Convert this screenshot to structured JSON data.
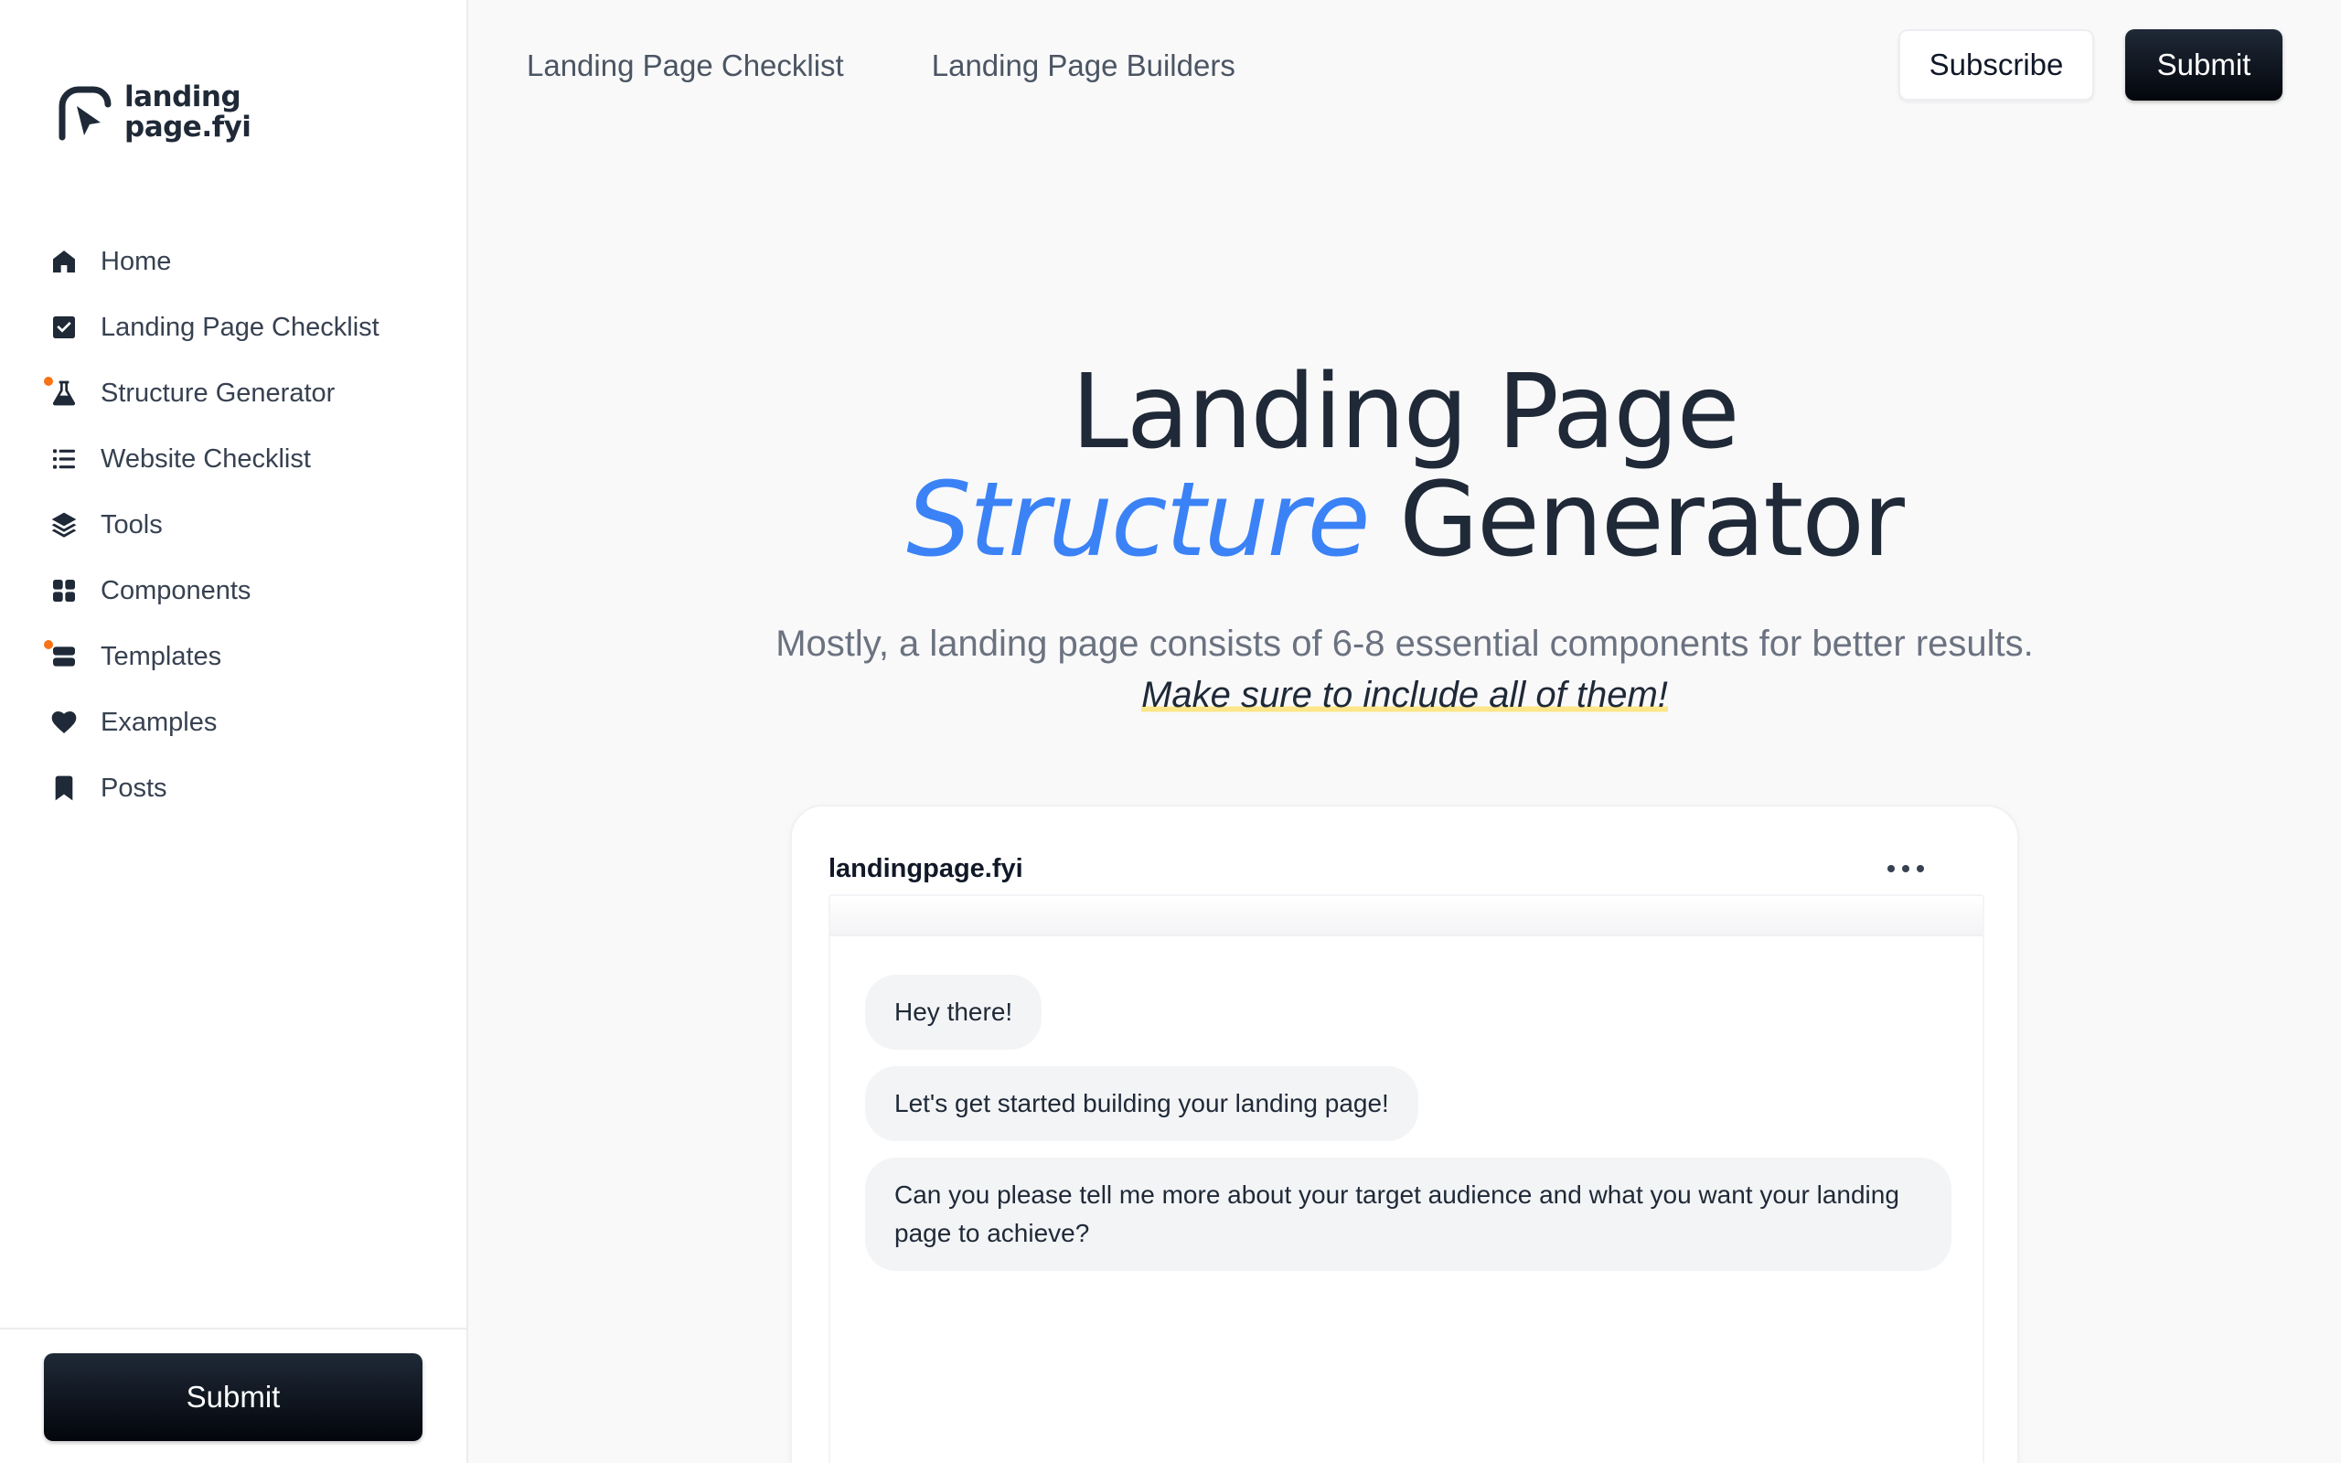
{
  "logo": {
    "line1": "landing",
    "line2": "page.fyi"
  },
  "sidebar": {
    "items": [
      {
        "label": "Home",
        "icon": "home-icon",
        "dot": false
      },
      {
        "label": "Landing Page Checklist",
        "icon": "check-square-icon",
        "dot": false
      },
      {
        "label": "Structure Generator",
        "icon": "flask-icon",
        "dot": true
      },
      {
        "label": "Website Checklist",
        "icon": "list-icon",
        "dot": false
      },
      {
        "label": "Tools",
        "icon": "layers-icon",
        "dot": false
      },
      {
        "label": "Components",
        "icon": "grid-icon",
        "dot": false
      },
      {
        "label": "Templates",
        "icon": "stack-icon",
        "dot": true
      },
      {
        "label": "Examples",
        "icon": "heart-icon",
        "dot": false
      },
      {
        "label": "Posts",
        "icon": "bookmark-icon",
        "dot": false
      }
    ],
    "submit_label": "Submit"
  },
  "topnav": {
    "links": [
      "Landing Page Checklist",
      "Landing Page Builders"
    ],
    "subscribe_label": "Subscribe",
    "submit_label": "Submit"
  },
  "hero": {
    "title_line1": "Landing Page",
    "title_accent": "Structure",
    "title_rest": " Generator",
    "subtitle": "Mostly, a landing page consists of 6-8 essential components for better results.",
    "subtitle_highlight": "Make sure to include all of them!"
  },
  "chat": {
    "title": "landingpage.fyi",
    "messages": [
      "Hey there!",
      "Let's get started building your landing page!",
      "Can you please tell me more about your target audience and what you want your landing page to achieve?"
    ]
  },
  "colors": {
    "accent": "#3b82f6",
    "dot": "#f97316",
    "highlight": "#fde68a",
    "button_dark": "#0b0f17"
  }
}
